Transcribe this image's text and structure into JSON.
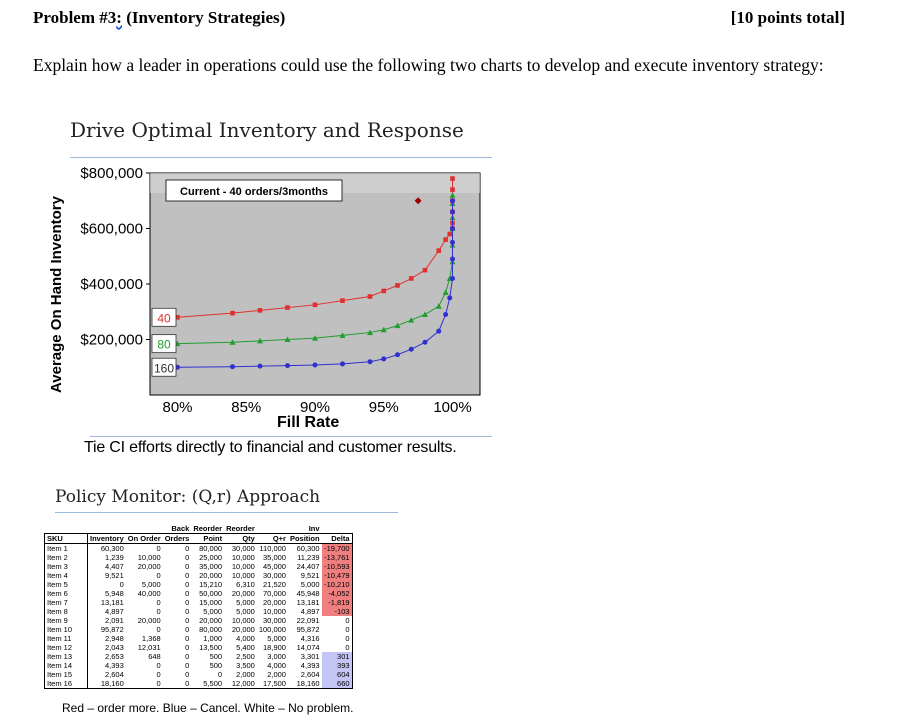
{
  "header": {
    "problem_prefix": "Problem #3",
    "problem_colon": ":",
    "problem_suffix": " (Inventory Strategies)",
    "points": "[10 points total]"
  },
  "question": "Explain how a leader in operations could use the following two charts to develop and execute inventory strategy:",
  "chart_data": [
    {
      "type": "line",
      "title": "Drive Optimal Inventory and Response",
      "xlabel": "Fill Rate",
      "ylabel": "Average On Hand Inventory",
      "x_ticks": [
        "80%",
        "85%",
        "90%",
        "95%",
        "100%"
      ],
      "y_ticks": [
        "$800,000",
        "$600,000",
        "$400,000",
        "$200,000"
      ],
      "xlim": [
        78,
        102
      ],
      "ylim": [
        0,
        800000
      ],
      "grid": false,
      "annotation": "Current - 40 orders/3months",
      "current_point": {
        "x": 97.5,
        "y": 700000
      },
      "footer": "Tie CI efforts directly to financial and customer results.",
      "series": [
        {
          "name": "40",
          "color": "#e03030",
          "marker": "square",
          "x": [
            80,
            84,
            86,
            88,
            90,
            92,
            94,
            95,
            96,
            97,
            98,
            99,
            99.5,
            99.8,
            100,
            100,
            100,
            100,
            100,
            100
          ],
          "y": [
            280000,
            295000,
            305000,
            315000,
            325000,
            340000,
            355000,
            375000,
            395000,
            420000,
            450000,
            520000,
            560000,
            580000,
            600000,
            620000,
            660000,
            700000,
            740000,
            780000
          ]
        },
        {
          "name": "80",
          "color": "#1e9e2e",
          "marker": "triangle",
          "x": [
            80,
            84,
            86,
            88,
            90,
            92,
            94,
            95,
            96,
            97,
            98,
            99,
            99.5,
            99.8,
            100,
            100,
            100,
            100,
            100,
            100
          ],
          "y": [
            185000,
            190000,
            195000,
            200000,
            205000,
            215000,
            225000,
            235000,
            250000,
            270000,
            290000,
            320000,
            370000,
            420000,
            480000,
            540000,
            600000,
            640000,
            690000,
            720000
          ]
        },
        {
          "name": "160",
          "color": "#3030d0",
          "marker": "circle",
          "x": [
            80,
            84,
            86,
            88,
            90,
            92,
            94,
            95,
            96,
            97,
            98,
            99,
            99.5,
            99.8,
            100,
            100,
            100,
            100,
            100,
            100
          ],
          "y": [
            100000,
            102000,
            104000,
            106000,
            108000,
            112000,
            120000,
            130000,
            145000,
            165000,
            190000,
            230000,
            290000,
            350000,
            420000,
            490000,
            550000,
            600000,
            660000,
            700000
          ]
        }
      ]
    },
    {
      "type": "table",
      "title": "Policy Monitor: (Q,r) Approach",
      "columns": [
        [
          "",
          "SKU"
        ],
        [
          "",
          "Inventory"
        ],
        [
          "",
          "On Order"
        ],
        [
          "Back",
          "Orders"
        ],
        [
          "Reorder",
          "Point"
        ],
        [
          "Reorder",
          "Qty"
        ],
        [
          "",
          "Q+r"
        ],
        [
          "Inv",
          "Position"
        ],
        [
          "",
          "Delta"
        ]
      ],
      "rows": [
        [
          "Item 1",
          "60,300",
          "0",
          "0",
          "80,000",
          "30,000",
          "110,000",
          "60,300",
          "-19,700"
        ],
        [
          "Item 2",
          "1,239",
          "10,000",
          "0",
          "25,000",
          "10,000",
          "35,000",
          "11,239",
          "-13,761"
        ],
        [
          "Item 3",
          "4,407",
          "20,000",
          "0",
          "35,000",
          "10,000",
          "45,000",
          "24,407",
          "-10,593"
        ],
        [
          "Item 4",
          "9,521",
          "0",
          "0",
          "20,000",
          "10,000",
          "30,000",
          "9,521",
          "-10,479"
        ],
        [
          "Item 5",
          "0",
          "5,000",
          "0",
          "15,210",
          "6,310",
          "21,520",
          "5,000",
          "-10,210"
        ],
        [
          "Item 6",
          "5,948",
          "40,000",
          "0",
          "50,000",
          "20,000",
          "70,000",
          "45,948",
          "-4,052"
        ],
        [
          "Item 7",
          "13,181",
          "0",
          "0",
          "15,000",
          "5,000",
          "20,000",
          "13,181",
          "-1,819"
        ],
        [
          "Item 8",
          "4,897",
          "0",
          "0",
          "5,000",
          "5,000",
          "10,000",
          "4,897",
          "-103"
        ],
        [
          "Item 9",
          "2,091",
          "20,000",
          "0",
          "20,000",
          "10,000",
          "30,000",
          "22,091",
          "0"
        ],
        [
          "Item 10",
          "95,872",
          "0",
          "0",
          "80,000",
          "20,000",
          "100,000",
          "95,872",
          "0"
        ],
        [
          "Item 11",
          "2,948",
          "1,368",
          "0",
          "1,000",
          "4,000",
          "5,000",
          "4,316",
          "0"
        ],
        [
          "Item 12",
          "2,043",
          "12,031",
          "0",
          "13,500",
          "5,400",
          "18,900",
          "14,074",
          "0"
        ],
        [
          "Item 13",
          "2,653",
          "648",
          "0",
          "500",
          "2,500",
          "3,000",
          "3,301",
          "301"
        ],
        [
          "Item 14",
          "4,393",
          "0",
          "0",
          "500",
          "3,500",
          "4,000",
          "4,393",
          "393"
        ],
        [
          "Item 15",
          "2,604",
          "0",
          "0",
          "0",
          "2,000",
          "2,000",
          "2,604",
          "604"
        ],
        [
          "Item 16",
          "18,160",
          "0",
          "0",
          "5,500",
          "12,000",
          "17,500",
          "18,160",
          "660"
        ]
      ],
      "delta_status": [
        "red",
        "red",
        "red",
        "red",
        "red",
        "red",
        "red",
        "red",
        "white",
        "white",
        "white",
        "white",
        "blue",
        "blue",
        "blue",
        "blue"
      ],
      "status_colors": {
        "red": "#f08080",
        "blue": "#c3c6f4",
        "white": "#ffffff"
      },
      "note": "Red – order more.  Blue – Cancel.  White – No problem."
    }
  ]
}
